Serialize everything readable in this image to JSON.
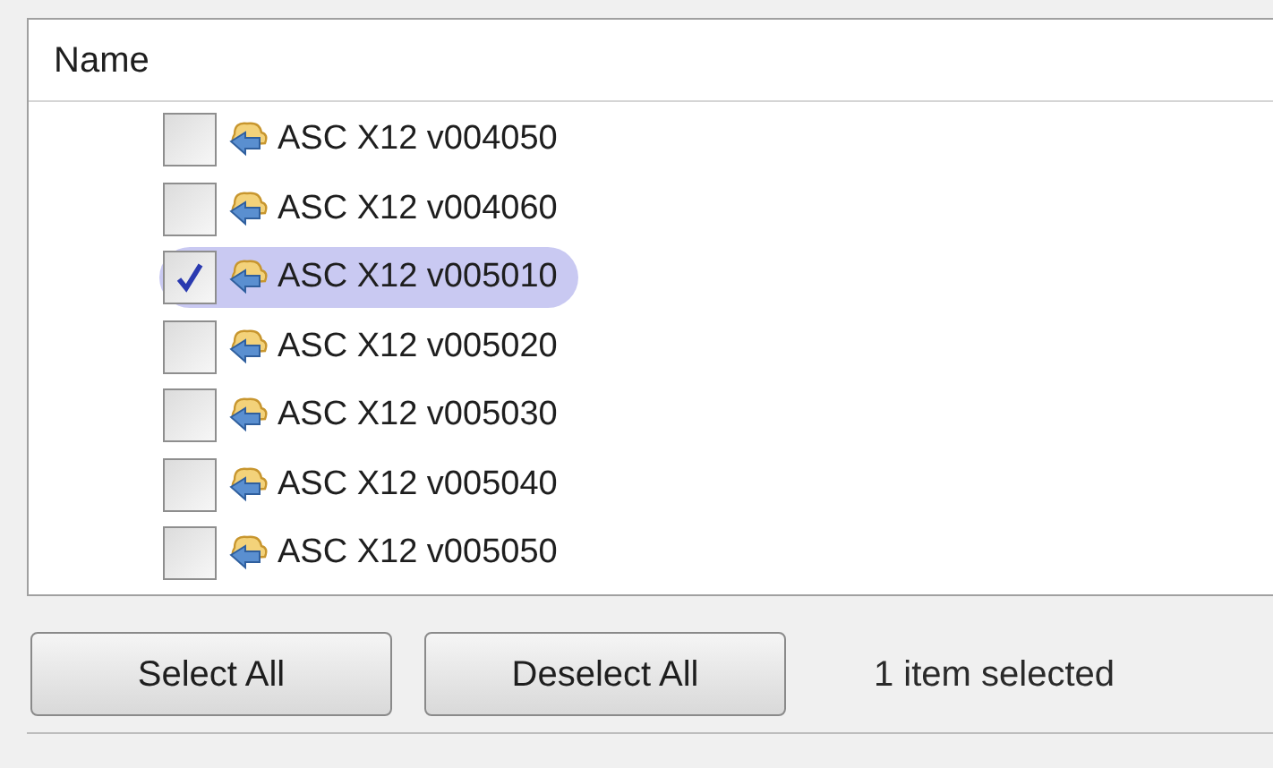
{
  "table": {
    "columns": [
      "Name"
    ],
    "rows": [
      {
        "label": "ASC X12 v004050",
        "checked": false,
        "selected": false
      },
      {
        "label": "ASC X12 v004060",
        "checked": false,
        "selected": false
      },
      {
        "label": "ASC X12 v005010",
        "checked": true,
        "selected": true
      },
      {
        "label": "ASC X12 v005020",
        "checked": false,
        "selected": false
      },
      {
        "label": "ASC X12 v005030",
        "checked": false,
        "selected": false
      },
      {
        "label": "ASC X12 v005040",
        "checked": false,
        "selected": false
      },
      {
        "label": "ASC X12 v005050",
        "checked": false,
        "selected": false
      }
    ]
  },
  "buttons": [
    "Select All",
    "Deselect All"
  ],
  "status": "1 item selected"
}
